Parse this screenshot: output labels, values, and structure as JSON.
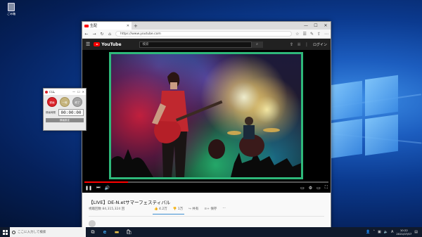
{
  "desktop": {
    "recycle_bin_label": "ごみ箱"
  },
  "browser": {
    "tab_title": "生配",
    "url": "https://www.youtube.com",
    "window_controls": [
      "—",
      "☐",
      "✕"
    ]
  },
  "youtube": {
    "logo_text": "YouTube",
    "search_placeholder": "検索",
    "login_label": "ログイン"
  },
  "video": {
    "title": "【LIVE】DE-N.etサマーフェスティバル",
    "views": "視聴回数 84,315,324 回",
    "like_count": "4.2万",
    "dislike_count": "1万",
    "share_label": "共有",
    "save_label": "保存",
    "progress_fraction": 0.18
  },
  "recorder": {
    "title": "ロム",
    "record_label": "録画",
    "pause_label": "一時",
    "stop_label": "終了",
    "time_label": "録画時間",
    "time_value": "00:00:00",
    "settings_label": "録画設定"
  },
  "taskbar": {
    "search_placeholder": "ここに入力して検索",
    "time": "10:22",
    "date": "2021/07/07"
  }
}
